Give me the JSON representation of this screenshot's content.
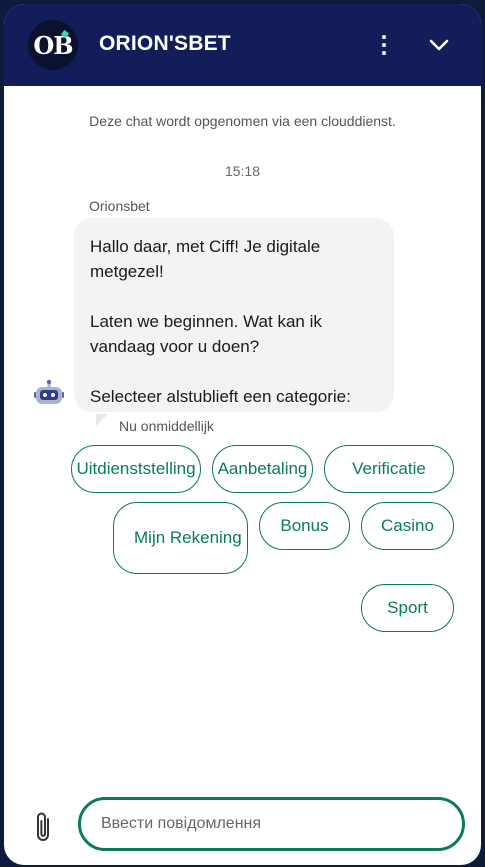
{
  "header": {
    "logo_text": "OB",
    "title": "ORION'SBET",
    "menu_icon": "vertical-ellipsis-icon",
    "collapse_icon": "chevron-down-icon",
    "brand_color": "#131d5a"
  },
  "chat": {
    "notice": "Deze chat wordt opgenomen via een clouddienst.",
    "time": "15:18",
    "sender": "Orionsbet",
    "message_lines": [
      "Hallo daar, met Ciff! Je digitale metgezel!",
      "Laten we beginnen. Wat kan ik vandaag voor u doen?",
      "Selecteer alstublieft een categorie:"
    ],
    "message_status": "Nu onmiddellijk",
    "avatar_icon": "robot-icon"
  },
  "quick_replies": [
    "Uitdienststelling",
    "Aanbetaling",
    "Verificatie",
    "Mijn Rekening",
    "Bonus",
    "Casino",
    "Sport"
  ],
  "composer": {
    "placeholder": "Ввести повідомлення",
    "attach_icon": "paperclip-icon",
    "accent_color": "#0a7d57"
  }
}
